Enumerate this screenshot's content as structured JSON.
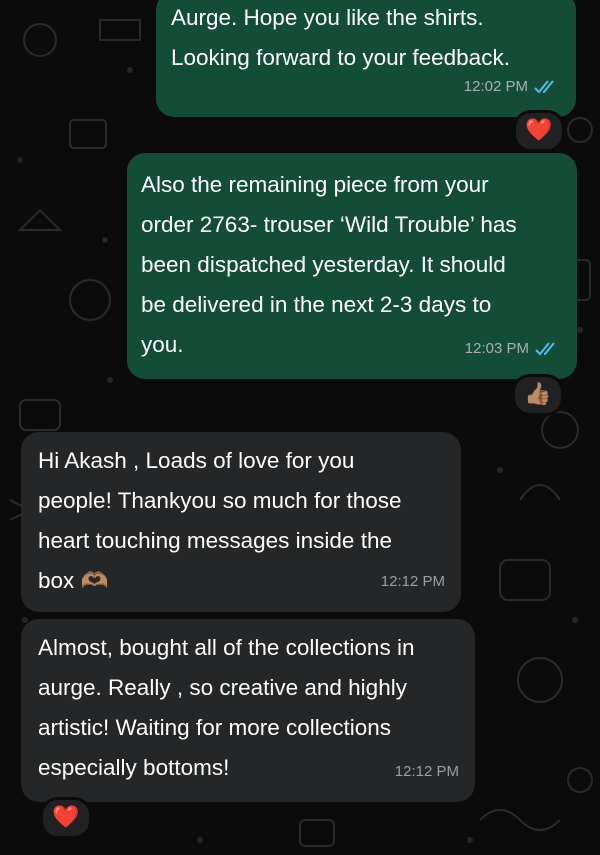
{
  "messages": [
    {
      "direction": "outgoing",
      "text": "Aurge. Hope you like the shirts.\nLooking forward to your feedback.",
      "time": "12:02 PM",
      "status": "read",
      "reaction": "❤️"
    },
    {
      "direction": "outgoing",
      "text": "Also the remaining piece from your\norder 2763- trouser ‘Wild Trouble’ has\nbeen dispatched yesterday. It should\nbe delivered in the next 2-3 days to\nyou.",
      "time": "12:03 PM",
      "status": "read",
      "reaction": "👍🏽"
    },
    {
      "direction": "incoming",
      "text": "Hi Akash , Loads of love for you\npeople! Thankyou so much for those\nheart touching messages inside the\nbox 🫶🏽",
      "time": "12:12 PM"
    },
    {
      "direction": "incoming",
      "text": "Almost, bought all of the collections in\naurge. Really , so creative and highly\nartistic! Waiting for more collections\nespecially bottoms!",
      "time": "12:12 PM",
      "reaction": "❤️"
    }
  ],
  "colors": {
    "outgoing_bubble": "#134d37",
    "incoming_bubble": "#242627",
    "read_ticks": "#53bdeb",
    "background": "#0b0b0b"
  },
  "icons": {
    "read_status": "double-check-icon"
  }
}
